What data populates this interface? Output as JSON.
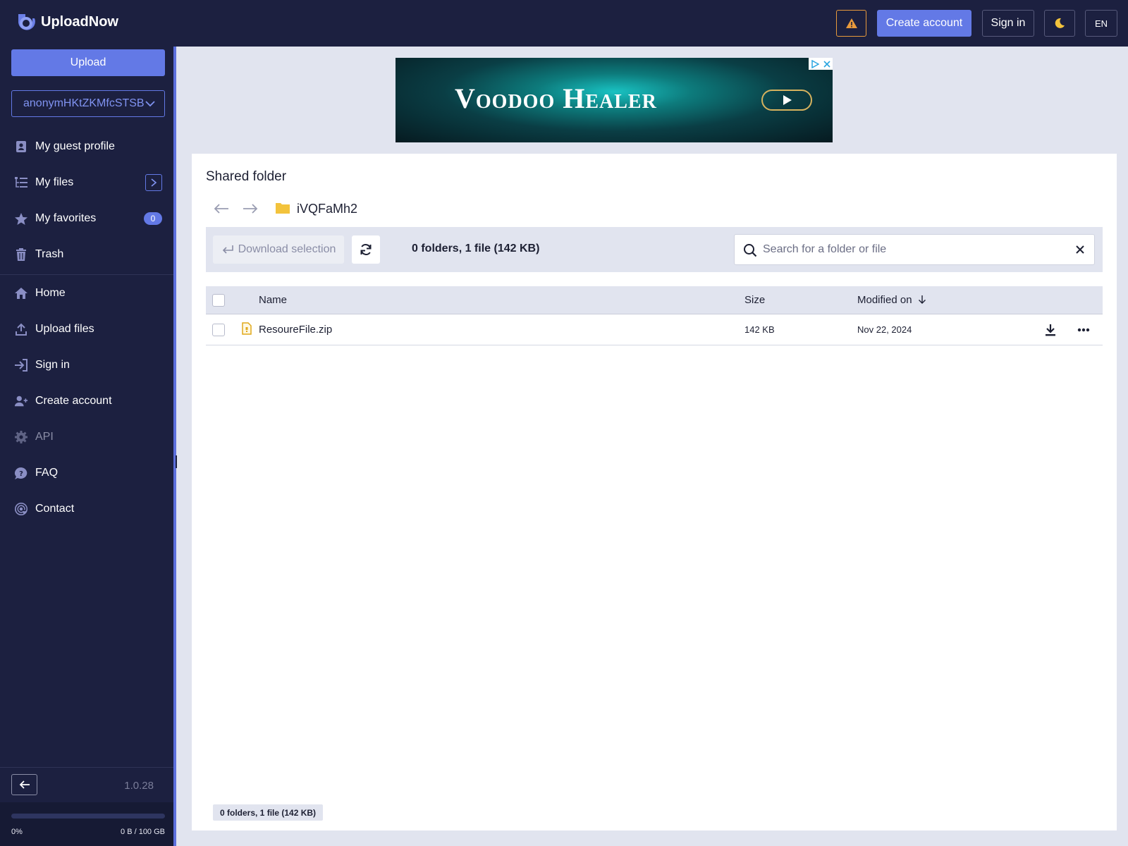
{
  "app": {
    "name": "UploadNow",
    "version": "1.0.28"
  },
  "colors": {
    "accent": "#6379e6",
    "navbar": "#1c2040",
    "warning": "#e89a3c",
    "folder": "#f3c33c"
  },
  "header": {
    "create_account": "Create account",
    "sign_in": "Sign in",
    "language": "EN",
    "icons": [
      "warning-icon",
      "moon-icon"
    ]
  },
  "sidebar": {
    "upload_label": "Upload",
    "account_name": "anonymHKtZKMfcSTSB",
    "items": [
      {
        "label": "My guest profile",
        "icon": "profile-card-icon"
      },
      {
        "label": "My files",
        "icon": "file-tree-icon"
      },
      {
        "label": "My favorites",
        "icon": "star-icon",
        "badge": "0"
      },
      {
        "label": "Trash",
        "icon": "trash-icon"
      },
      {
        "label": "Home",
        "icon": "home-icon"
      },
      {
        "label": "Upload files",
        "icon": "upload-icon"
      },
      {
        "label": "Sign in",
        "icon": "sign-in-icon"
      },
      {
        "label": "Create account",
        "icon": "add-user-icon"
      },
      {
        "label": "API",
        "icon": "gear-icon",
        "disabled": true
      },
      {
        "label": "FAQ",
        "icon": "question-bubble-icon"
      },
      {
        "label": "Contact",
        "icon": "at-sign-icon"
      }
    ],
    "storage": {
      "percent_label": "0%",
      "used_label": "0 B / 100 GB",
      "fraction": 0
    }
  },
  "ad": {
    "title": "Voodoo Healer"
  },
  "main": {
    "title": "Shared folder",
    "folder_name": "iVQFaMh2",
    "download_selection": "Download selection",
    "summary": "0 folders, 1 file (142 KB)",
    "search_placeholder": "Search for a folder or file",
    "columns": {
      "name": "Name",
      "size": "Size",
      "modified": "Modified on"
    },
    "files": [
      {
        "name": "ResoureFile.zip",
        "size": "142 KB",
        "modified": "Nov 22, 2024",
        "icon": "zip-file-icon"
      }
    ],
    "footer_summary": "0 folders, 1 file (142 KB)"
  }
}
